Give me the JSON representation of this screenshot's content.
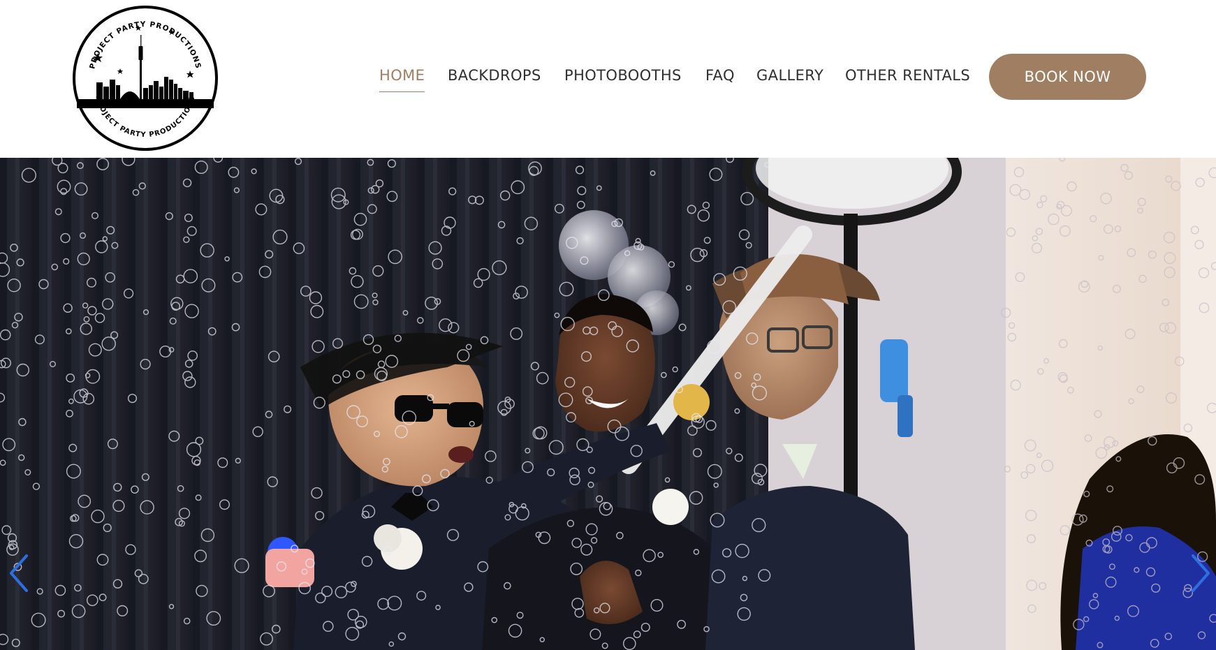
{
  "logo": {
    "text_top": "PROJECT PARTY PRODUCTIONS",
    "text_bottom": "PROJECT PARTY PRODUCTIONS"
  },
  "nav": {
    "items": [
      {
        "label": "HOME",
        "active": true
      },
      {
        "label": "BACKDROPS",
        "active": false
      },
      {
        "label": "PHOTOBOOTHS",
        "active": false
      },
      {
        "label": "FAQ",
        "active": false
      },
      {
        "label": "GALLERY",
        "active": false
      },
      {
        "label": "OTHER RENTALS",
        "active": false
      }
    ]
  },
  "cta": {
    "book_label": "BOOK NOW"
  },
  "slider": {
    "prev_icon": "chevron-left-icon",
    "next_icon": "chevron-right-icon"
  },
  "colors": {
    "accent": "#a07e62",
    "nav_text": "#2f2f2f",
    "arrow": "#2d6fe0"
  }
}
